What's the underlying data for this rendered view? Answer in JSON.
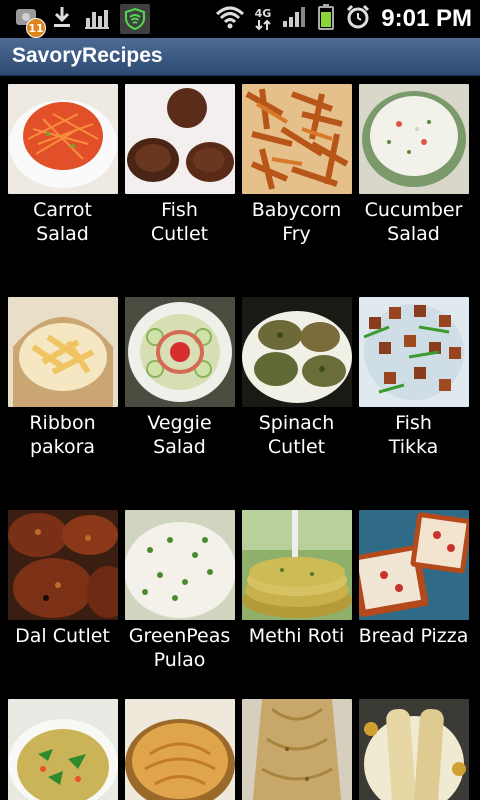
{
  "status_bar": {
    "notification_count": "11",
    "network_type": "4G",
    "time": "9:01 PM",
    "icons": [
      "app-notification-icon",
      "download-icon",
      "chart-icon",
      "shield-icon",
      "wifi-icon",
      "signal-icon",
      "battery-icon",
      "alarm-icon"
    ]
  },
  "app": {
    "title": "SavoryRecipes"
  },
  "colors": {
    "title_bar": "#3c5a84",
    "background": "#000000"
  },
  "recipes": [
    {
      "label": "Carrot\nSalad"
    },
    {
      "label": "Fish\nCutlet"
    },
    {
      "label": "Babycorn\nFry"
    },
    {
      "label": "Cucumber\nSalad"
    },
    {
      "label": "Ribbon\npakora"
    },
    {
      "label": "Veggie\nSalad"
    },
    {
      "label": "Spinach\nCutlet"
    },
    {
      "label": "Fish\nTikka"
    },
    {
      "label": "Dal Cutlet"
    },
    {
      "label": "GreenPeas\nPulao"
    },
    {
      "label": "Methi Roti"
    },
    {
      "label": "Bread Pizza"
    },
    {
      "label": ""
    },
    {
      "label": ""
    },
    {
      "label": ""
    },
    {
      "label": ""
    }
  ]
}
